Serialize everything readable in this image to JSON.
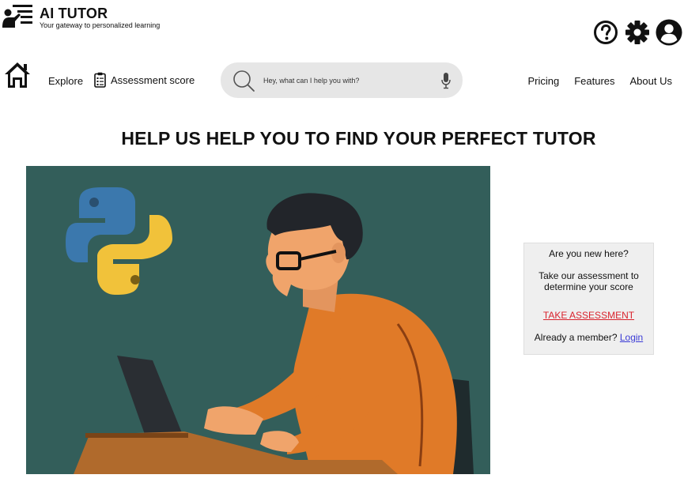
{
  "brand": {
    "title": "AI TUTOR",
    "tagline": "Your gateway to personalized learning"
  },
  "nav": {
    "explore": "Explore",
    "assessment": "Assessment score",
    "right": [
      "Pricing",
      "Features",
      "About Us"
    ]
  },
  "search": {
    "placeholder": "Hey, what can I help you with?"
  },
  "headline": "HELP US HELP YOU TO FIND YOUR PERFECT TUTOR",
  "card": {
    "question": "Are you new here?",
    "description": "Take our assessment to determine your score",
    "cta": "TAKE ASSESSMENT",
    "member_prompt": "Already a member?",
    "login": "Login"
  },
  "icons": {
    "top": [
      "help-icon",
      "settings-icon",
      "account-icon"
    ],
    "search": "search-icon",
    "mic": "microphone-icon",
    "home": "home-icon",
    "assessment": "clipboard-icon"
  },
  "colors": {
    "hero_bg": "#335e5a",
    "cta": "#d9232d",
    "link": "#3b3bd6",
    "search_bg": "#e6e6e6",
    "card_bg": "#efefef"
  }
}
